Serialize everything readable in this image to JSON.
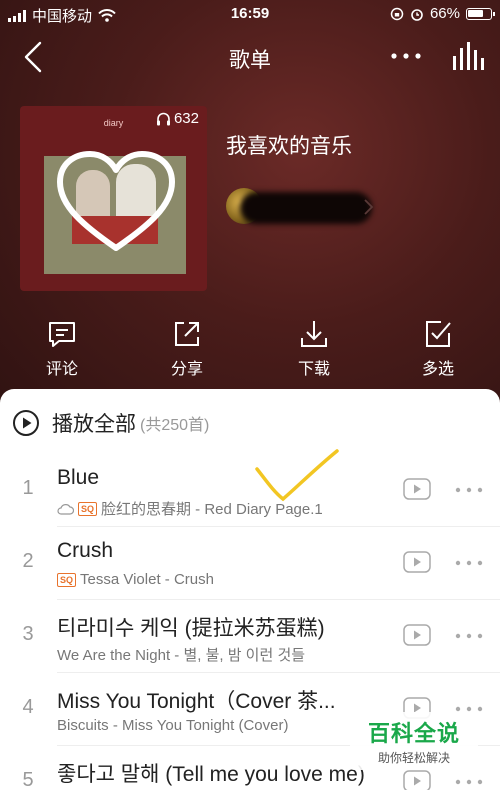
{
  "status_bar": {
    "carrier": "中国移动",
    "time": "16:59",
    "battery": "66%"
  },
  "nav": {
    "title": "歌单"
  },
  "playlist": {
    "cover_count": "632",
    "cover_text": "diary",
    "name": "我喜欢的音乐"
  },
  "actions": [
    {
      "label": "评论",
      "icon": "comment-icon"
    },
    {
      "label": "分享",
      "icon": "share-icon"
    },
    {
      "label": "下载",
      "icon": "download-icon"
    },
    {
      "label": "多选",
      "icon": "multi-select-icon"
    }
  ],
  "list": {
    "play_all_label": "播放全部",
    "play_all_count": "(共250首)"
  },
  "songs": [
    {
      "index": "1",
      "title": "Blue",
      "subtitle": "脸红的思春期 - Red Diary Page.1",
      "sq": "SQ",
      "cloud": true
    },
    {
      "index": "2",
      "title": "Crush",
      "subtitle": "Tessa Violet - Crush",
      "sq": "SQ",
      "cloud": false
    },
    {
      "index": "3",
      "title": "티라미수 케익 (提拉米苏蛋糕)",
      "subtitle": "We Are the Night - 별, 불, 밤 이런 것들",
      "sq": "",
      "cloud": false
    },
    {
      "index": "4",
      "title": "Miss You Tonight（Cover 茶...",
      "subtitle": "Biscuits - Miss You Tonight (Cover)",
      "sq": "",
      "cloud": false
    },
    {
      "index": "5",
      "title": "좋다고 말해 (Tell me you love me)",
      "subtitle": "",
      "sq": "",
      "cloud": false
    }
  ],
  "watermark": {
    "title": "百科全说",
    "subtitle": "助你轻松解决"
  },
  "colors": {
    "header_bg": "#4a1c1a",
    "sq_accent": "#e8732c",
    "watermark_green": "#1aa84a"
  }
}
